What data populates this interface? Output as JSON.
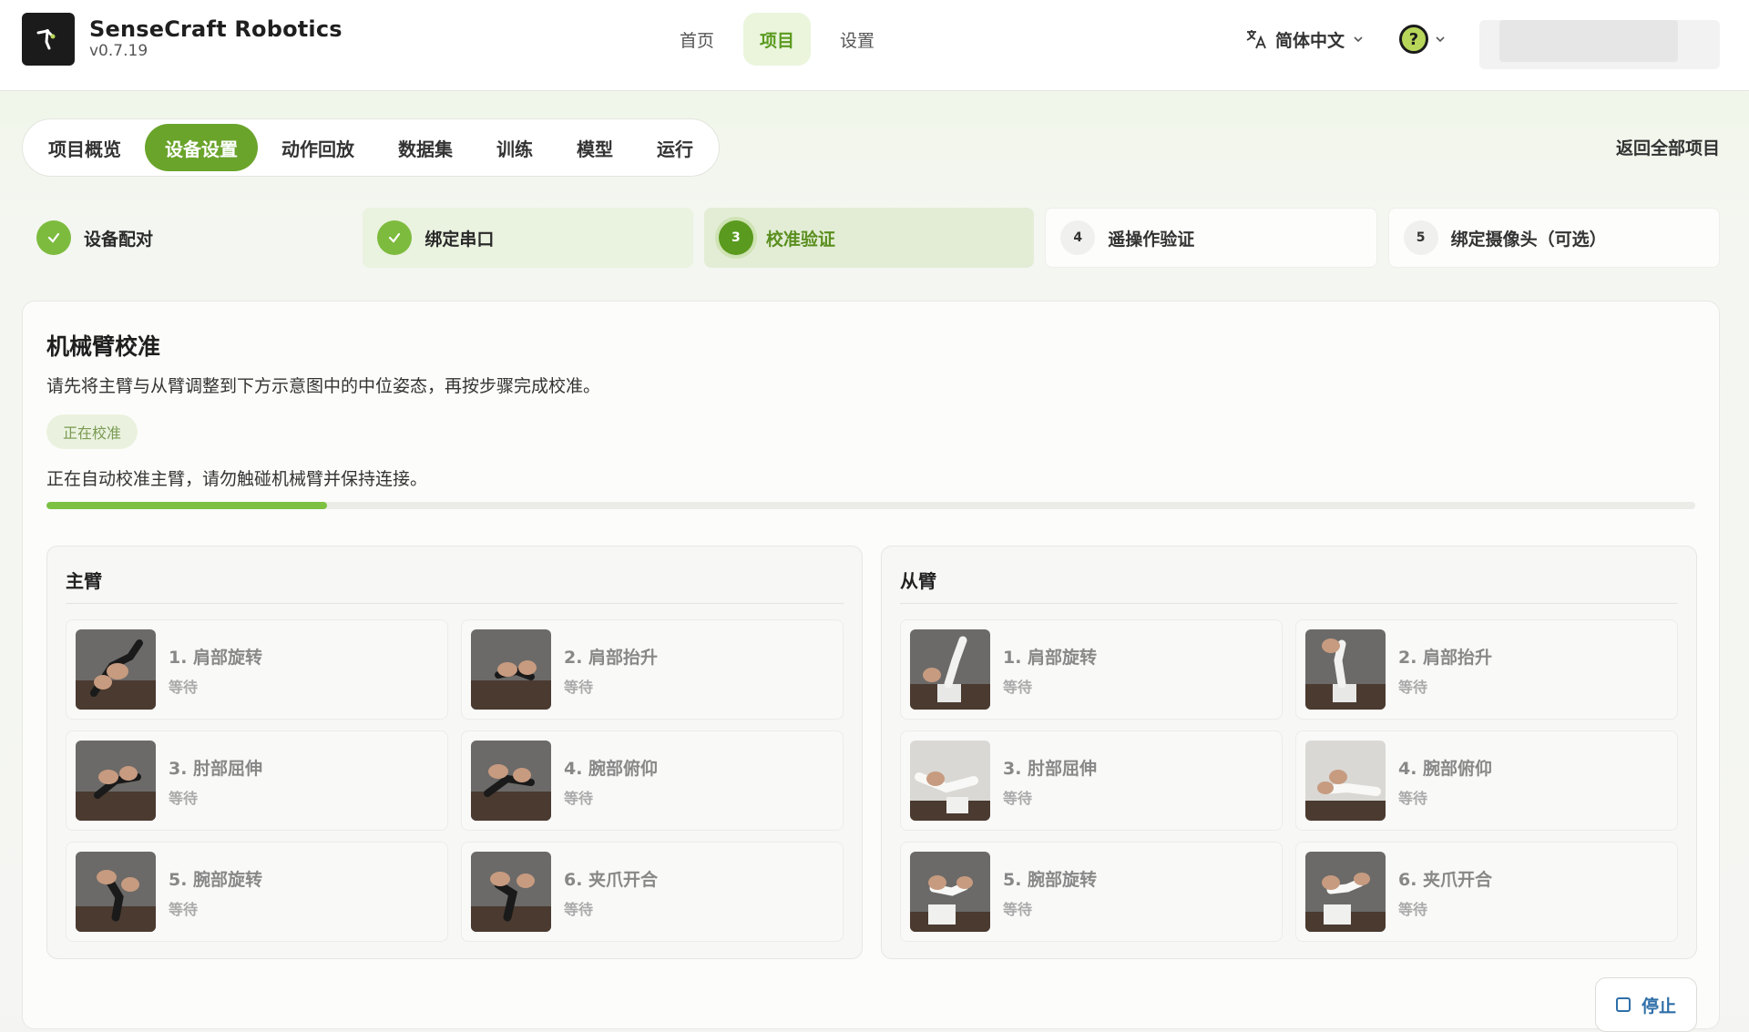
{
  "app": {
    "name": "SenseCraft Robotics",
    "version": "v0.7.19",
    "logo_icon": "robot-arm-logo"
  },
  "main_nav": [
    {
      "label": "首页",
      "active": false
    },
    {
      "label": "项目",
      "active": true
    },
    {
      "label": "设置",
      "active": false
    }
  ],
  "header": {
    "language": "简体中文",
    "help_glyph": "?"
  },
  "project_tabs": [
    {
      "label": "项目概览",
      "active": false
    },
    {
      "label": "设备设置",
      "active": true
    },
    {
      "label": "动作回放",
      "active": false
    },
    {
      "label": "数据集",
      "active": false
    },
    {
      "label": "训练",
      "active": false
    },
    {
      "label": "模型",
      "active": false
    },
    {
      "label": "运行",
      "active": false
    }
  ],
  "back_link": "返回全部项目",
  "steps": [
    {
      "num": "1",
      "label": "设备配对",
      "state": "done"
    },
    {
      "num": "2",
      "label": "绑定串口",
      "state": "done"
    },
    {
      "num": "3",
      "label": "校准验证",
      "state": "current"
    },
    {
      "num": "4",
      "label": "遥操作验证",
      "state": "todo"
    },
    {
      "num": "5",
      "label": "绑定摄像头（可选）",
      "state": "todo"
    }
  ],
  "calibration": {
    "title": "机械臂校准",
    "description": "请先将主臂与从臂调整到下方示意图中的中位姿态，再按步骤完成校准。",
    "badge": "正在校准",
    "status_text": "正在自动校准主臂，请勿触碰机械臂并保持连接。",
    "progress": 0.17,
    "stop_label": "停止"
  },
  "arms": [
    {
      "title": "主臂",
      "joints": [
        {
          "name": "1. 肩部旋转",
          "status": "等待"
        },
        {
          "name": "2. 肩部抬升",
          "status": "等待"
        },
        {
          "name": "3. 肘部屈伸",
          "status": "等待"
        },
        {
          "name": "4. 腕部俯仰",
          "status": "等待"
        },
        {
          "name": "5. 腕部旋转",
          "status": "等待"
        },
        {
          "name": "6. 夹爪开合",
          "status": "等待"
        }
      ]
    },
    {
      "title": "从臂",
      "joints": [
        {
          "name": "1. 肩部旋转",
          "status": "等待"
        },
        {
          "name": "2. 肩部抬升",
          "status": "等待"
        },
        {
          "name": "3. 肘部屈伸",
          "status": "等待"
        },
        {
          "name": "4. 腕部俯仰",
          "status": "等待"
        },
        {
          "name": "5. 腕部旋转",
          "status": "等待"
        },
        {
          "name": "6. 夹爪开合",
          "status": "等待"
        }
      ]
    }
  ],
  "colors": {
    "accent": "#6aa42b",
    "progress": "#7cc142",
    "stop": "#2f6fa8"
  }
}
